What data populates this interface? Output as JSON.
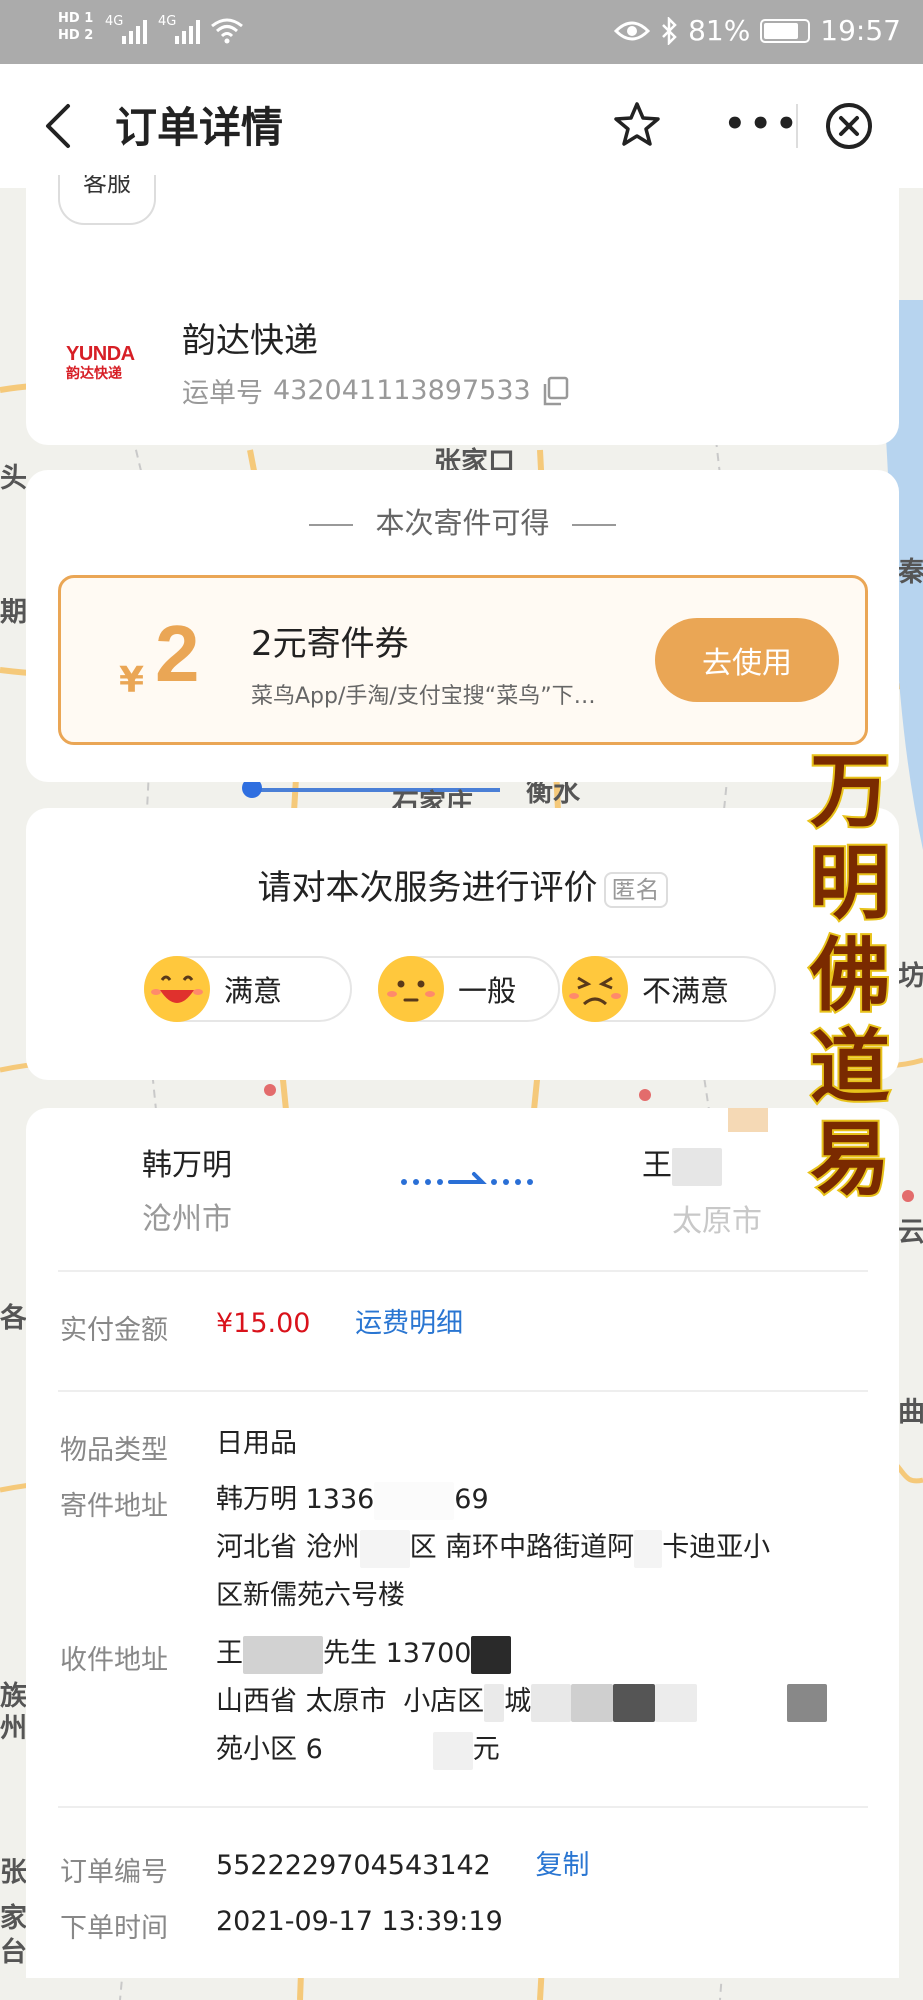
{
  "status_bar": {
    "sim1": "HD 1",
    "sim2": "HD 2",
    "net1": "4G",
    "net2": "4G",
    "battery": "81%",
    "time": "19:57",
    "battery_level": 0.81
  },
  "header": {
    "title": "订单详情"
  },
  "carrier": {
    "partial_pill": "客服",
    "logo_en": "YUNDA",
    "logo_cn": "韵达快递",
    "name": "韵达快递",
    "waybill_prefix": "运单号",
    "waybill_number": "432041113897533"
  },
  "coupon": {
    "heading": "本次寄件可得",
    "currency": "¥",
    "amount": "2",
    "title": "2元寄件券",
    "desc": "菜鸟App/手淘/支付宝搜“菜鸟”下…",
    "button": "去使用"
  },
  "rating": {
    "question": "请对本次服务进行评价",
    "anon": "匿名",
    "options": [
      {
        "label": "满意",
        "icon": "happy-face-icon"
      },
      {
        "label": "一般",
        "icon": "neutral-face-icon"
      },
      {
        "label": "不满意",
        "icon": "unhappy-face-icon"
      }
    ]
  },
  "shipment": {
    "sender_name": "韩万明",
    "sender_city": "沧州市",
    "receiver_name": "王",
    "receiver_city": "太原市",
    "paid_label": "实付金额",
    "paid_value": "¥15.00",
    "fee_link": "运费明细",
    "item_label": "物品类型",
    "item_value": "日用品",
    "send_addr_label": "寄件地址",
    "send_line1": "韩万明 1336",
    "send_line1_tail": "69",
    "send_line2a": "河北省 沧州",
    "send_line2b": "区 南环中路街道阿",
    "send_line2c": "卡迪亚小",
    "send_line3": "区新儒苑六号楼",
    "recv_addr_label": "收件地址",
    "recv_line1a": "王",
    "recv_line1b": "先生 13700",
    "recv_line2a": "山西省 太原市",
    "recv_line2b": "小店区",
    "recv_line2c": "城",
    "recv_line3a": "苑小区 6",
    "recv_line3b": "元",
    "order_label": "订单编号",
    "order_value": "5522229704543142",
    "copy_link": "复制",
    "time_label": "下单时间",
    "time_value": "2021-09-17 13:39:19"
  },
  "map": {
    "labels": [
      "张家口",
      "石家庄",
      "衡水",
      "头",
      "期",
      "秦",
      "坊",
      "各",
      "族",
      "州",
      "张",
      "家",
      "台",
      "云",
      "曲"
    ]
  },
  "overlay": {
    "chars": [
      "万",
      "明",
      "佛",
      "道",
      "易"
    ]
  }
}
